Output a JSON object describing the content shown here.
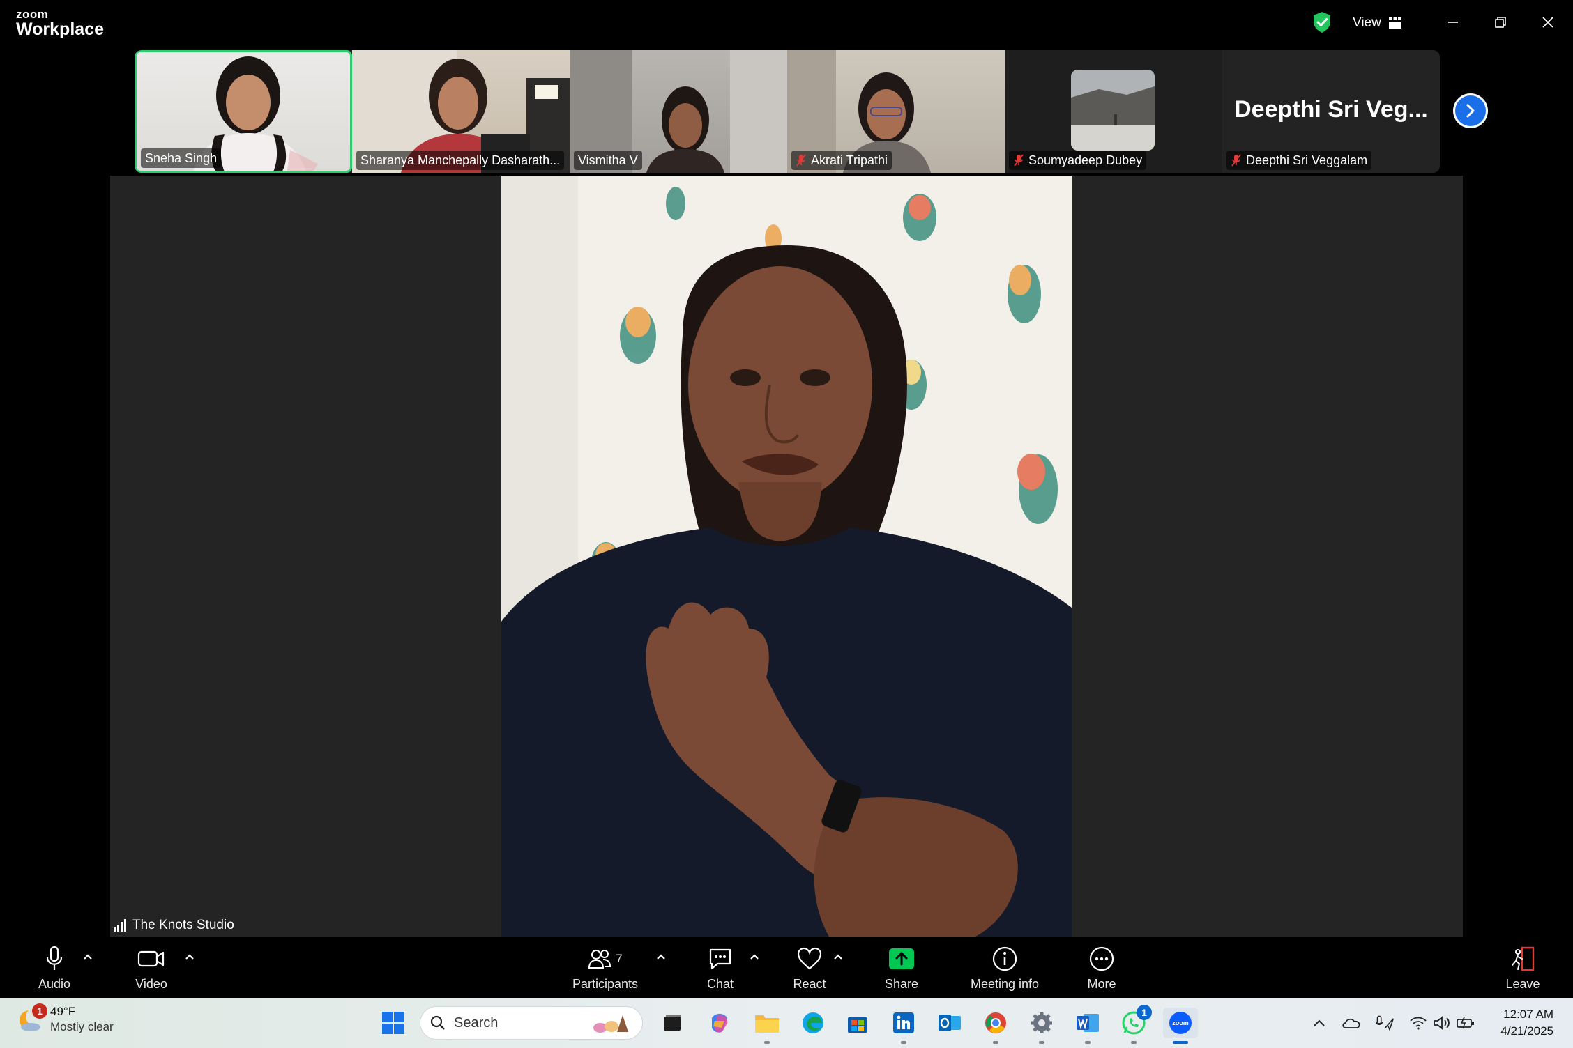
{
  "app": {
    "brand_small": "zoom",
    "brand_big": "Workplace",
    "view_label": "View"
  },
  "participants_strip": [
    {
      "name": "Sneha Singh",
      "muted": false,
      "active": true
    },
    {
      "name": "Sharanya Manchepally Dasharath...",
      "muted": false,
      "active": false
    },
    {
      "name": "Vismitha V",
      "muted": false,
      "active": false
    },
    {
      "name": "Akrati Tripathi",
      "muted": true,
      "active": false
    },
    {
      "name": "Soumyadeep Dubey",
      "muted": true,
      "active": false
    },
    {
      "name": "Deepthi Sri Veggalam",
      "display_big": "Deepthi Sri Veg...",
      "muted": true,
      "active": false
    }
  ],
  "stage": {
    "speaker_label": "The Knots Studio"
  },
  "toolbar": {
    "audio": "Audio",
    "video": "Video",
    "participants": "Participants",
    "participants_count": "7",
    "chat": "Chat",
    "react": "React",
    "share": "Share",
    "meeting_info": "Meeting info",
    "more": "More",
    "leave": "Leave"
  },
  "taskbar": {
    "weather_temp": "49°F",
    "weather_desc": "Mostly clear",
    "weather_badge": "1",
    "search_placeholder": "Search",
    "whatsapp_badge": "1",
    "zoom_icon_text": "zoom",
    "time": "12:07 AM",
    "date": "4/21/2025"
  },
  "colors": {
    "active_border": "#2ecc71",
    "share_green": "#00c853",
    "leave_red": "#e53935",
    "accent_blue": "#1a6fe8"
  }
}
